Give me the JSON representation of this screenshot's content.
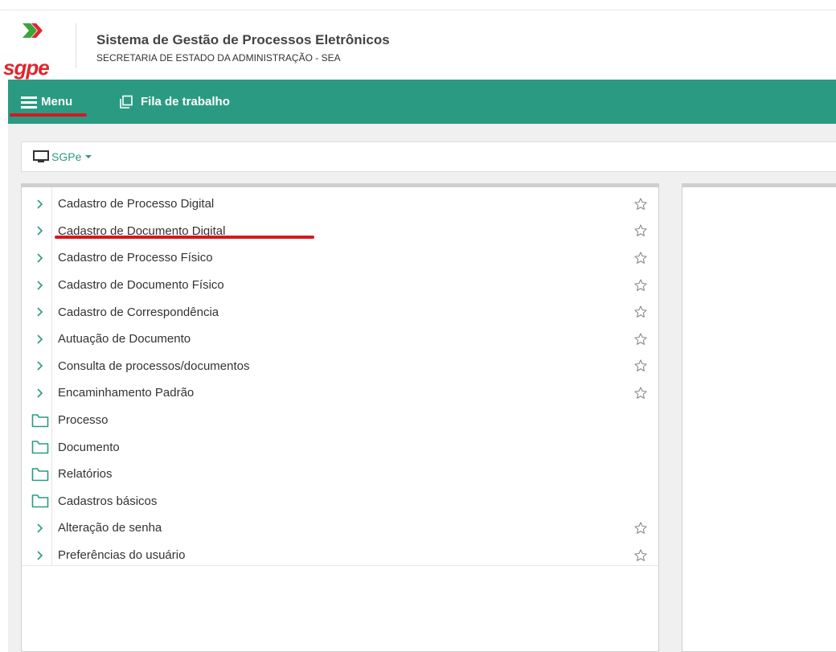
{
  "header": {
    "logo_text": "sgpe",
    "title": "Sistema de Gestão de Processos Eletrônicos",
    "subtitle": "SECRETARIA DE ESTADO DA ADMINISTRAÇÃO - SEA"
  },
  "navbar": {
    "menu_label": "Menu",
    "fila_label": "Fila de trabalho",
    "color": "#2a9b82"
  },
  "breadcrumb": {
    "label": "SGPe",
    "icon": "monitor-icon"
  },
  "menu": {
    "items": [
      {
        "label": "Cadastro de Processo Digital",
        "type": "link"
      },
      {
        "label": "Cadastro de Documento Digital",
        "type": "link"
      },
      {
        "label": "Cadastro de Processo Físico",
        "type": "link"
      },
      {
        "label": "Cadastro de Documento Físico",
        "type": "link"
      },
      {
        "label": "Cadastro de Correspondência",
        "type": "link"
      },
      {
        "label": "Autuação de Documento",
        "type": "link"
      },
      {
        "label": "Consulta de processos/documentos",
        "type": "link"
      },
      {
        "label": "Encaminhamento Padrão",
        "type": "link"
      },
      {
        "label": "Processo",
        "type": "folder"
      },
      {
        "label": "Documento",
        "type": "folder"
      },
      {
        "label": "Relatórios",
        "type": "folder"
      },
      {
        "label": "Cadastros básicos",
        "type": "folder"
      },
      {
        "label": "Alteração de senha",
        "type": "link"
      },
      {
        "label": "Preferências do usuário",
        "type": "link"
      }
    ]
  },
  "colors": {
    "accent": "#2a9b82",
    "annotation": "#d8171f",
    "brand_red": "#e0262e"
  }
}
